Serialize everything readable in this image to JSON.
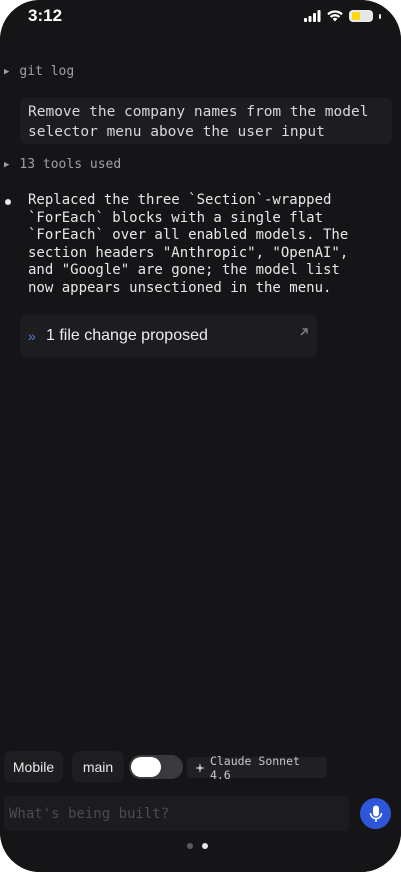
{
  "status_bar": {
    "time": "3:12"
  },
  "conversation": {
    "git_log_label": "git log",
    "user_message": "Remove the company names from the model\nselector menu above the user input",
    "tools_used_label": "13 tools used",
    "assistant_message": "Replaced the three `Section`-wrapped\n`ForEach` blocks with a single flat\n`ForEach` over all enabled models. The\nsection headers \"Anthropic\", \"OpenAI\",\nand \"Google\" are gone; the model list\nnow appears unsectioned in the menu.",
    "file_change": {
      "label": "1 file change proposed",
      "chevron": "»",
      "open_icon": "arrow-up-right-icon"
    }
  },
  "toolbar": {
    "platform_chip": "Mobile",
    "branch_chip": "main",
    "toggle_on": false,
    "model_chip": "Claude Sonnet 4.6"
  },
  "composer": {
    "placeholder": "What's being built?",
    "mic_icon": "microphone-icon"
  },
  "pager": {
    "count": 2,
    "active_index": 1
  },
  "colors": {
    "accent": "#2d57d8",
    "battery": "#ffd60a",
    "background": "#151517"
  }
}
